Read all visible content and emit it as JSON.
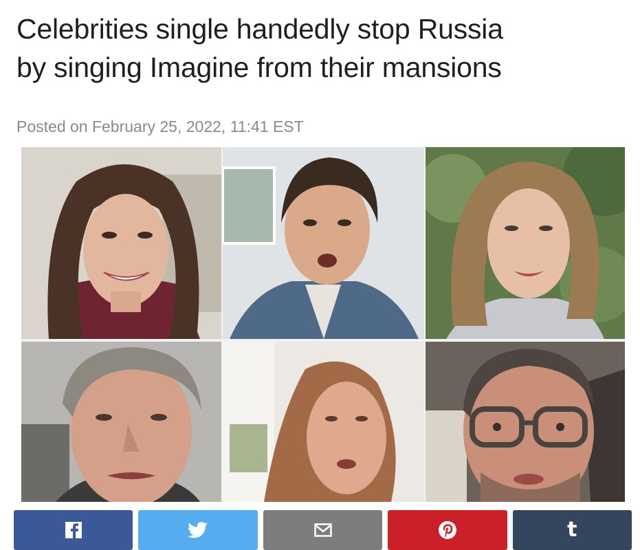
{
  "article": {
    "headline_line1": "Celebrities single handedly stop Russia",
    "headline_line2": "by singing Imagine from their mansions",
    "posted": "Posted on February 25, 2022, 11:41 EST"
  },
  "video_grid": {
    "tiles": [
      {
        "name": "woman-dark-hair-smiling",
        "background": "#d9d4cc",
        "hair": "#4a3326",
        "skin": "#e2b79e",
        "clothing": "#6e2531"
      },
      {
        "name": "man-denim-jacket-singing",
        "background": "#dfe3e6",
        "hair": "#3a2b20",
        "skin": "#d9a98a",
        "clothing": "#4f6a86"
      },
      {
        "name": "woman-outdoors-singing",
        "background": "#5f7a48",
        "hair": "#9c7a52",
        "skin": "#e6bfa6",
        "clothing": "#c8c8cf"
      },
      {
        "name": "man-gray-hair",
        "background": "#b8b6b2",
        "hair": "#8d8880",
        "skin": "#d4a08a",
        "clothing": "#3a3a3a"
      },
      {
        "name": "woman-strawberry-blonde",
        "background": "#ece9e4",
        "hair": "#a26a47",
        "skin": "#e0a98e",
        "clothing": "#b98a6c"
      },
      {
        "name": "man-glasses-beard",
        "background": "#6b625b",
        "hair": "#4f4540",
        "skin": "#c98f78",
        "clothing": "#2e2a28"
      }
    ]
  },
  "share": {
    "buttons": [
      {
        "name": "facebook",
        "icon": "facebook-icon",
        "color": "#3b5998"
      },
      {
        "name": "twitter",
        "icon": "twitter-icon",
        "color": "#55acee"
      },
      {
        "name": "email",
        "icon": "email-icon",
        "color": "#7d7d7d"
      },
      {
        "name": "pinterest",
        "icon": "pinterest-icon",
        "color": "#cb2027"
      },
      {
        "name": "tumblr",
        "icon": "tumblr-icon",
        "color": "#34465d",
        "glyph": "t"
      }
    ]
  }
}
